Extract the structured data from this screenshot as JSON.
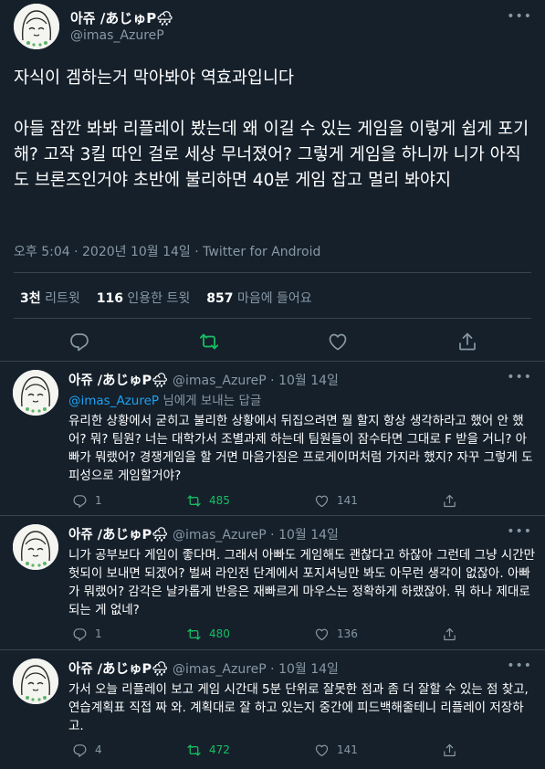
{
  "main_tweet": {
    "author_name": "아쥬 /あじゅP🌧",
    "author_handle": "@imas_AzureP",
    "text": "자식이 겜하는거 막아봐야 역효과입니다\n\n아들 잠깐 봐봐 리플레이 봤는데 왜 이길 수 있는 게임을 이렇게 쉽게 포기해? 고작 3킬 따인 걸로 세상 무너졌어? 그렇게 게임을 하니까 니가 아직도 브론즈인거야 초반에 불리하면 40분 게임 잡고 멀리 봐야지",
    "meta": "오후 5:04 · 2020년 10월 14일 · Twitter for Android",
    "stats": {
      "retweets_count": "3천",
      "retweets_label": " 리트윗",
      "quotes_count": "116",
      "quotes_label": " 인용한 트윗",
      "likes_count": "857",
      "likes_label": " 마음에 들어요"
    },
    "icons": [
      "reply-icon",
      "retweet-icon",
      "like-icon",
      "share-icon"
    ]
  },
  "replies": [
    {
      "author_name": "아쥬 /あじゅP🌧",
      "author_handle": "@imas_AzureP",
      "date": "10월 14일",
      "replying_to_handle": "@imas_AzureP",
      "replying_to_suffix": " 님에게 보내는 답글",
      "text": "유리한 상황에서 굳히고 불리한 상황에서 뒤집으려면 뭘 할지 항상 생각하라고 했어 안 했어? 뭐? 팀원? 너는 대학가서 조별과제 하는데 팀원들이 잠수타면 그대로 F 받을 거니? 아빠가 뭐랬어? 경쟁게임을 할 거면 마음가짐은 프로게이머처럼 가지라 했지? 자꾸 그렇게 도피성으로 게임할거야?",
      "reply_count": "1",
      "retweet_count": "485",
      "like_count": "141"
    },
    {
      "author_name": "아쥬 /あじゅP🌧",
      "author_handle": "@imas_AzureP",
      "date": "10월 14일",
      "text": "니가 공부보다 게임이 좋다며. 그래서 아빠도 게임해도 괜찮다고 하잖아 그런데 그냥 시간만 헛되이 보내면 되겠어? 벌써 라인전 단계에서 포지셔닝만 봐도 아무런 생각이 없잖아. 아빠가 뭐랬어? 감각은 날카롭게 반응은 재빠르게 마우스는 정확하게 하랬잖아. 뭐 하나 제대로 되는 게 없네?",
      "reply_count": "1",
      "retweet_count": "480",
      "like_count": "136"
    },
    {
      "author_name": "아쥬 /あじゅP🌧",
      "author_handle": "@imas_AzureP",
      "date": "10월 14일",
      "text": "가서 오늘 리플레이 보고 게임 시간대 5분 단위로 잘못한 점과 좀 더 잘할 수 있는 점 찾고, 연습계획표 직접 짜 와. 계획대로 잘 하고 있는지 중간에 피드백해줄테니 리플레이 저장하고.",
      "reply_count": "4",
      "retweet_count": "472",
      "like_count": "141"
    }
  ],
  "colors": {
    "background": "#15202b",
    "text": "#ffffff",
    "muted": "#8899a6",
    "link": "#1da1f2",
    "retweeted_green": "#17bf63",
    "divider": "#38444d"
  }
}
